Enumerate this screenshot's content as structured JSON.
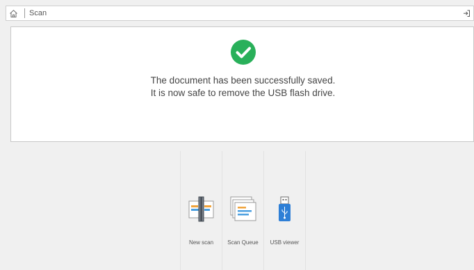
{
  "header": {
    "home_icon": "home-icon",
    "title": "Scan",
    "exit_icon": "exit-icon"
  },
  "message": {
    "icon": "success-check-icon",
    "icon_color": "#29b05a",
    "line1": "The document has been successfully saved.",
    "line2": "It is now safe to remove the USB flash drive."
  },
  "actions": [
    {
      "label": "New scan",
      "icon": "new-scan-icon"
    },
    {
      "label": "Scan Queue",
      "icon": "scan-queue-icon"
    },
    {
      "label": "USB viewer",
      "icon": "usb-viewer-icon"
    }
  ]
}
